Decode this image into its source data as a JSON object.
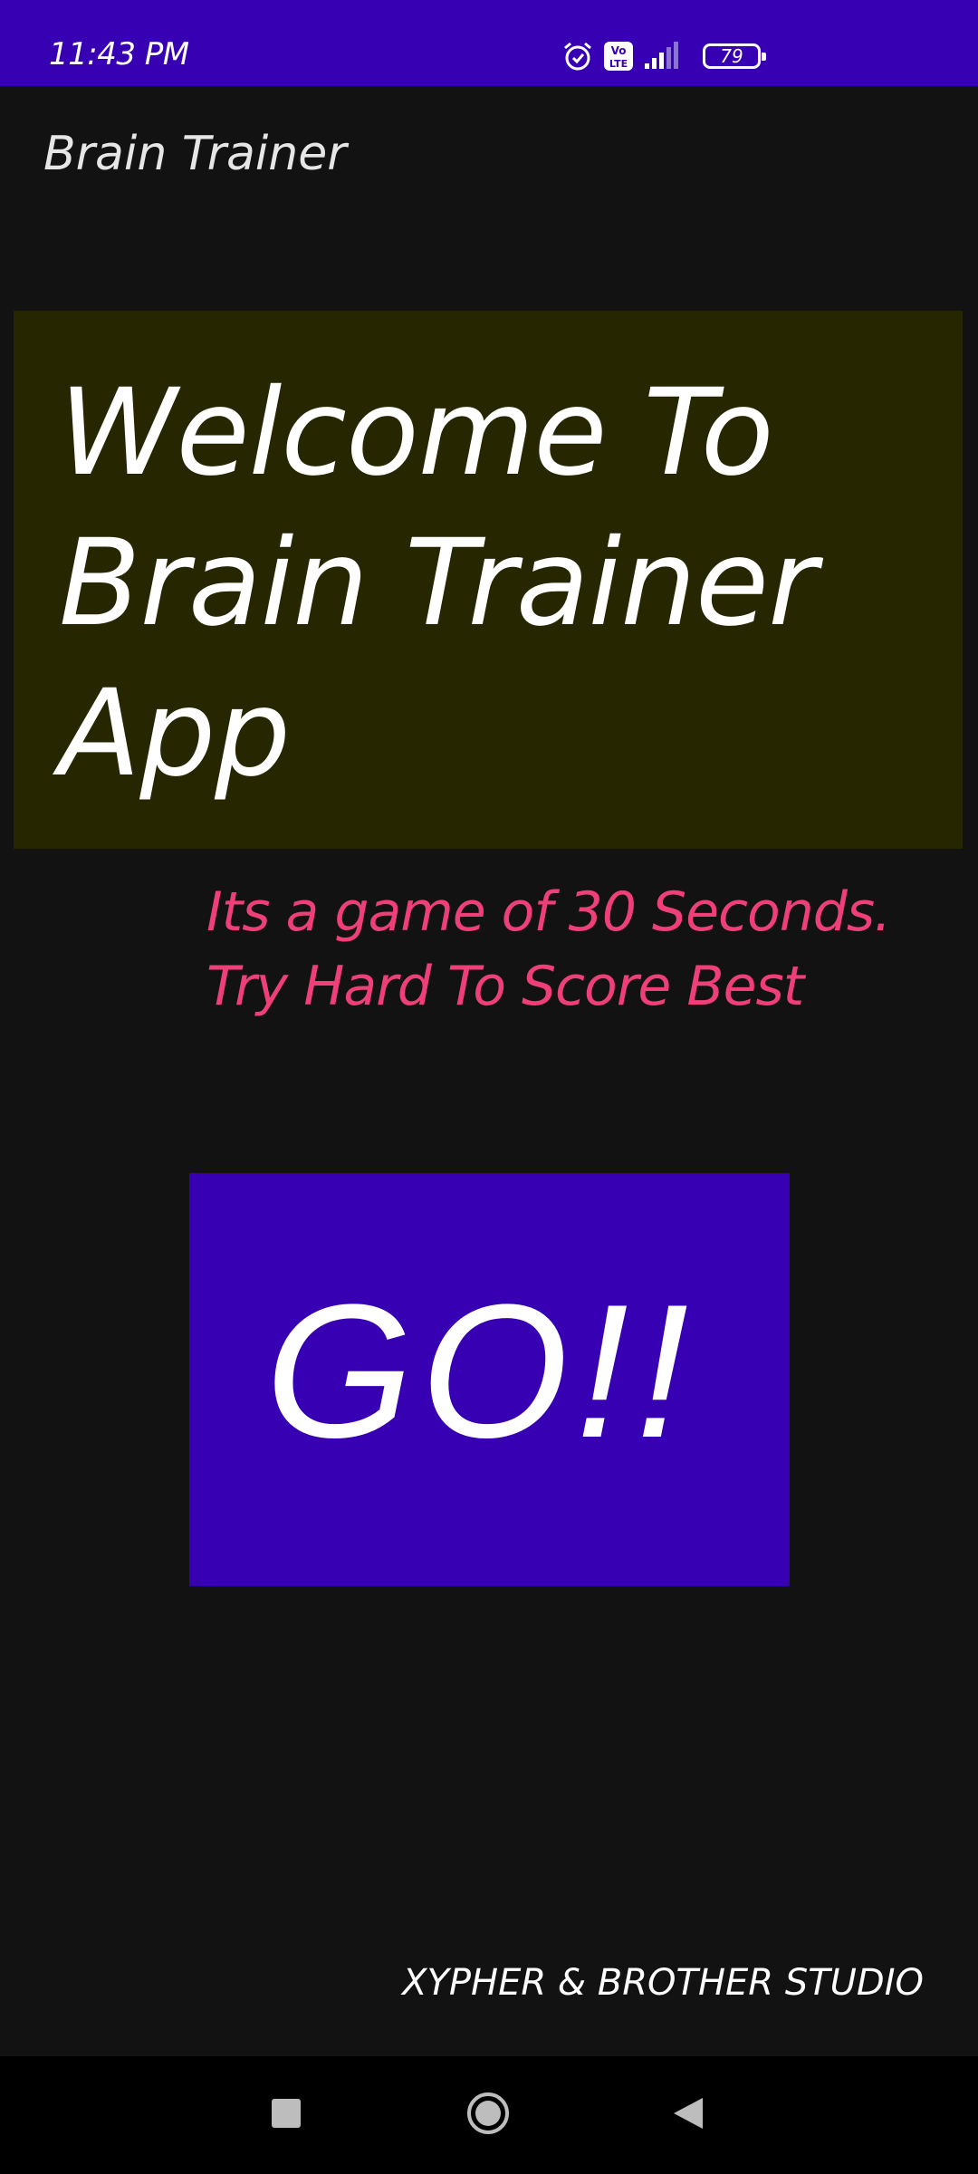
{
  "status_bar": {
    "time": "11:43 PM",
    "battery_level": "79",
    "icons": [
      "alarm-icon",
      "volte-icon",
      "signal-icon",
      "battery-icon"
    ]
  },
  "app_bar": {
    "title": "Brain Trainer"
  },
  "welcome": {
    "heading": "Welcome To Brain Trainer App"
  },
  "tagline": {
    "text": "Its a game of 30 Seconds. Try Hard To Score Best"
  },
  "go_button": {
    "label": "GO!!"
  },
  "footer": {
    "credit": "XYPHER & BROTHER STUDIO"
  },
  "nav_bar": {
    "buttons": [
      "recents-icon",
      "home-icon",
      "back-icon"
    ]
  },
  "colors": {
    "status_bar": "#3700b3",
    "background": "#121212",
    "welcome_panel": "#262600",
    "tagline": "#ef3f78",
    "go_button": "#3700b3"
  }
}
